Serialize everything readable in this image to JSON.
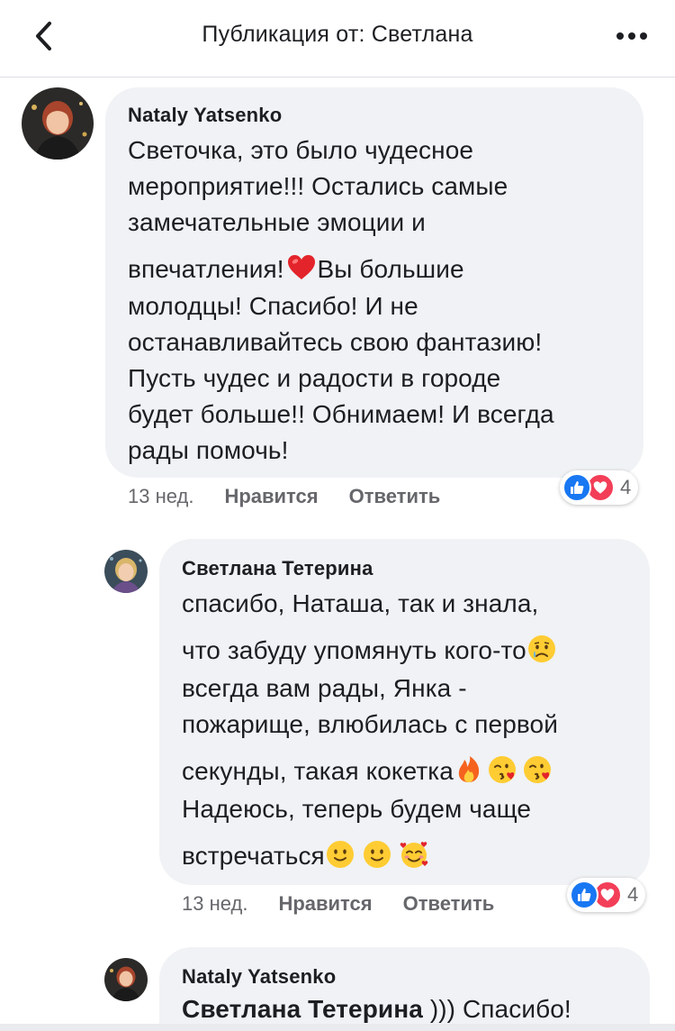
{
  "header": {
    "title": "Публикация от: Светлана",
    "back_icon": "chevron-left-icon",
    "more_icon": "more-horizontal-icon"
  },
  "comments": [
    {
      "author": "Nataly Yatsenko",
      "lines": [
        "Светочка, это было чудесное",
        "мероприятие!!! Остались самые",
        "замечательные эмоции и",
        "впечатления! ",
        "Вы большие",
        "молодцы!   Спасибо! И не",
        "останавливайтесь свою фантазию!",
        "Пусть чудес и радости в городе",
        "будет больше!! Обнимаем! И всегда",
        "рады помочь!"
      ],
      "time": "13 нед.",
      "like_label": "Нравится",
      "reply_label": "Ответить",
      "reaction_count": "4"
    },
    {
      "author": "Светлана Тетерина",
      "lines": [
        "спасибо, Наташа, так и знала,",
        "что забуду упомянуть кого-то",
        "всегда вам рады, Янка -",
        "пожарище, влюбилась с первой",
        "секунды, такая кокетка",
        "Надеюсь, теперь будем чаще",
        "встречаться"
      ],
      "time": "13 нед.",
      "like_label": "Нравится",
      "reply_label": "Ответить",
      "reaction_count": "4"
    },
    {
      "author": "Nataly Yatsenko",
      "mention": "Светлана Тетерина",
      "text": " ))) Спасибо!"
    }
  ],
  "colors": {
    "bubble": "#f0f2f5",
    "like": "#1877f2",
    "love": "#f33e58",
    "meta": "#65676b"
  }
}
